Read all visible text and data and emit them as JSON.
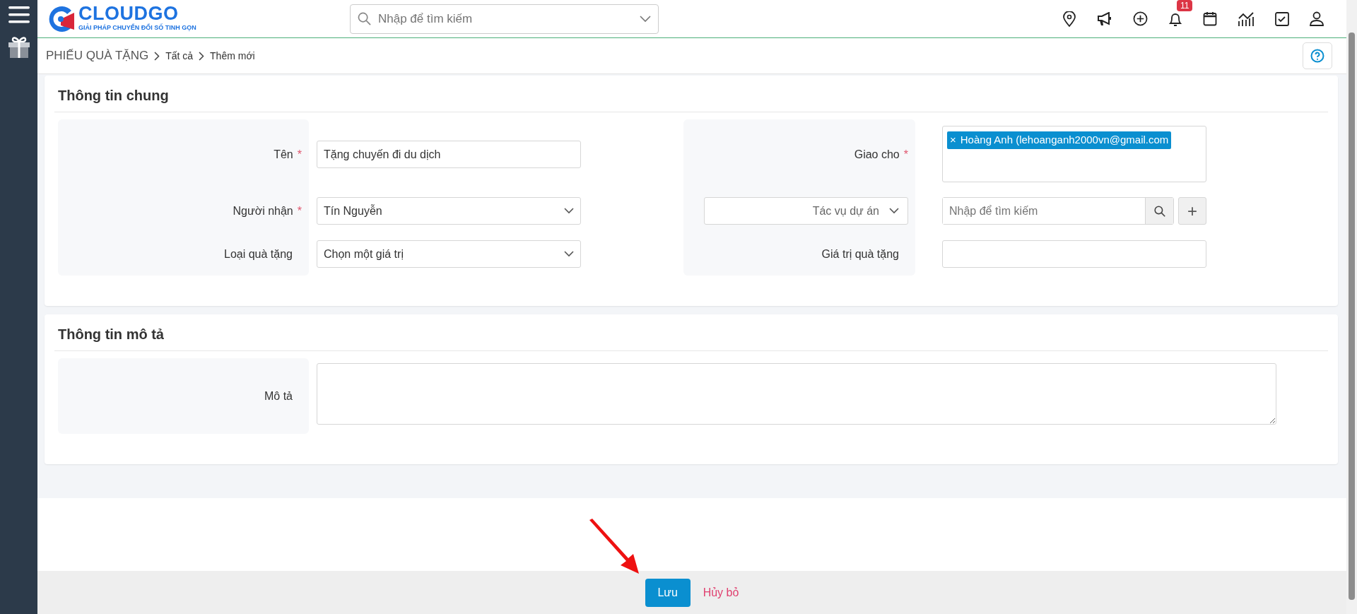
{
  "header": {
    "logo_text": "CLOUDGO",
    "logo_tagline": "GIẢI PHÁP CHUYỂN ĐỔI SỐ TINH GỌN",
    "search_placeholder": "Nhập để tìm kiếm",
    "notification_count": "11"
  },
  "breadcrumb": [
    "PHIẾU QUÀ TẶNG",
    "Tất cả",
    "Thêm mới"
  ],
  "sections": [
    {
      "title": "Thông tin chung",
      "columns": [
        [
          {
            "kind": "text",
            "label": "Tên",
            "required_mark": "*",
            "value": "Tặng chuyến đi du dịch"
          },
          {
            "kind": "select",
            "label": "Người nhận",
            "required_mark": "*",
            "value": "Tín Nguyễn"
          },
          {
            "kind": "select",
            "label": "Loại quà tặng",
            "value": "Chọn một giá trị"
          }
        ],
        [
          {
            "kind": "tags",
            "label": "Giao cho",
            "required_mark": "*",
            "tags": [
              {
                "remove": "×",
                "label": "Hoàng Anh (lehoanganh2000vn@gmail.com"
              }
            ]
          },
          {
            "kind": "lookup",
            "selector": "Tác vụ dự án",
            "placeholder": "Nhập để tìm kiếm",
            "add": "+"
          },
          {
            "kind": "text",
            "label": "Giá trị quà tặng"
          }
        ]
      ]
    },
    {
      "title": "Thông tin mô tả",
      "columns": [
        [
          {
            "kind": "textarea",
            "label": "Mô tả"
          }
        ]
      ]
    }
  ],
  "footer": {
    "save": "Lưu",
    "cancel": "Hủy bỏ"
  }
}
